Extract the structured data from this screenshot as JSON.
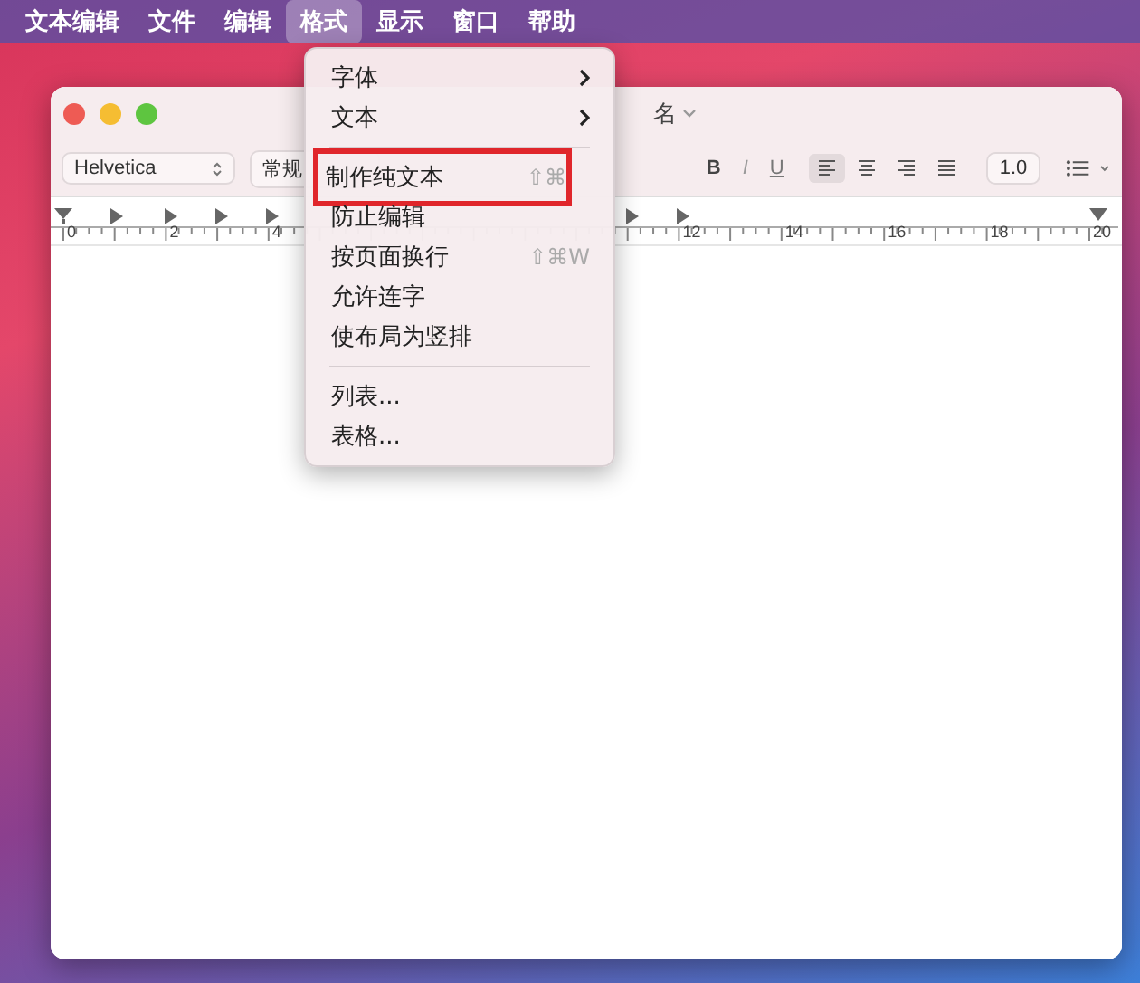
{
  "menubar": [
    {
      "label": "文本编辑",
      "selected": false
    },
    {
      "label": "文件",
      "selected": false
    },
    {
      "label": "编辑",
      "selected": false
    },
    {
      "label": "格式",
      "selected": true
    },
    {
      "label": "显示",
      "selected": false
    },
    {
      "label": "窗口",
      "selected": false
    },
    {
      "label": "帮助",
      "selected": false
    }
  ],
  "window": {
    "title": "名",
    "toolbar": {
      "font": "Helvetica",
      "style": "常规",
      "align": [
        {
          "kind": "left",
          "selected": true
        },
        {
          "kind": "center",
          "selected": false
        },
        {
          "kind": "right",
          "selected": false
        },
        {
          "kind": "justify",
          "selected": false
        }
      ],
      "spacing": "1.0",
      "format_buttons": [
        "B",
        "I",
        "U"
      ]
    },
    "ruler": {
      "labels": [
        "0",
        "2",
        "4",
        "12",
        "14",
        "16",
        "18",
        "20"
      ]
    }
  },
  "menu": {
    "items": [
      {
        "kind": "submenu",
        "label": "字体",
        "highlighted": false
      },
      {
        "kind": "submenu",
        "label": "文本",
        "highlighted": false
      },
      {
        "kind": "separator"
      },
      {
        "kind": "item",
        "label": "制作纯文本",
        "shortcut": "⇧⌘",
        "highlighted": true
      },
      {
        "kind": "item",
        "label": "防止编辑",
        "highlighted": false
      },
      {
        "kind": "item",
        "label": "按页面换行",
        "shortcut": "⇧⌘W",
        "highlighted": false
      },
      {
        "kind": "item",
        "label": "允许连字",
        "highlighted": false
      },
      {
        "kind": "item",
        "label": "使布局为竖排",
        "highlighted": false
      },
      {
        "kind": "separator"
      },
      {
        "kind": "item",
        "label": "列表...",
        "highlighted": false
      },
      {
        "kind": "item",
        "label": "表格...",
        "highlighted": false
      }
    ]
  }
}
